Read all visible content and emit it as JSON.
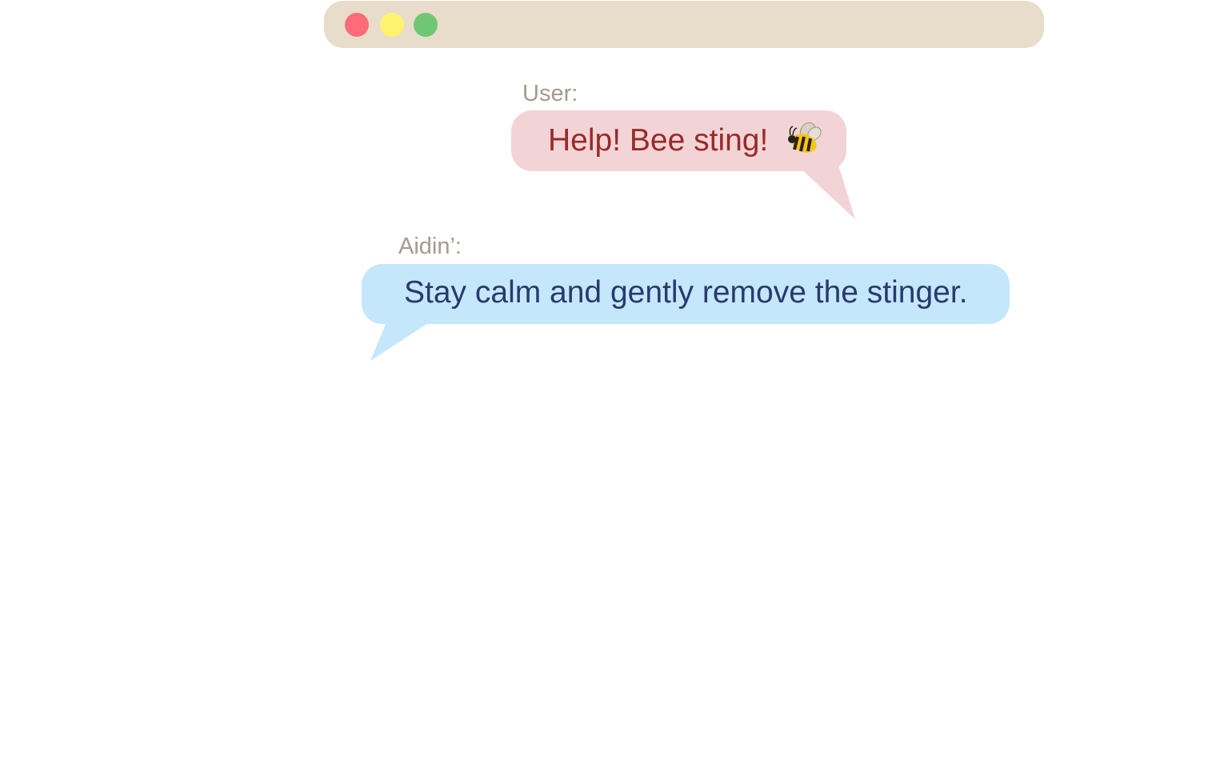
{
  "window": {
    "controls": {
      "close_color": "#ff6b78",
      "minimize_color": "#fff36d",
      "maximize_color": "#6fc773"
    },
    "titlebar_color": "#e8dcca"
  },
  "conversation": {
    "messages": [
      {
        "speaker": "User:",
        "text": "Help! Bee sting!",
        "emoji_icon": "bee-icon",
        "bubble_color": "#f2d4d6",
        "text_color": "#9a2a2a",
        "speaker_color": "#a59a8e"
      },
      {
        "speaker": "Aidin’:",
        "text": "Stay calm and gently remove the stinger.",
        "bubble_color": "#c5e7fb",
        "text_color": "#283a6e",
        "speaker_color": "#a59a8e"
      }
    ]
  }
}
